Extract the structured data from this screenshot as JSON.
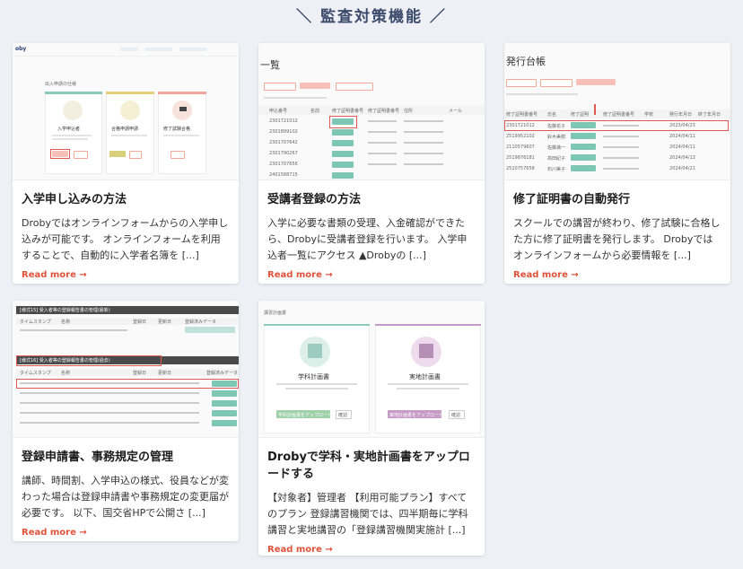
{
  "section": {
    "title": "＼ 監査対策機能 ／"
  },
  "cards": [
    {
      "title": "入学申し込みの方法",
      "excerpt": "Drobyではオンラインフォームからの入学申し込みが可能です。 オンラインフォームを利用することで、自動的に入学者名簿を [...]",
      "read_more": "Read more →",
      "thumb": {
        "logo": "oby",
        "heading": "出入申請の仕様",
        "items": [
          "入学申込者",
          "合格申請申請",
          "修了試験合格"
        ]
      }
    },
    {
      "title": "受講者登録の方法",
      "excerpt": "入学に必要な書類の受理、入金確認ができたら、Drobyに受講者登録を行います。 入学申込者一覧にアクセス ▲Drobyの [...]",
      "read_more": "Read more →",
      "thumb": {
        "heading": "一覧",
        "cols": [
          "申込番号",
          "名前",
          "修了証明書番号",
          "修了証明書番号",
          "住所",
          "メール"
        ],
        "rows": [
          "2301721012",
          "2301899102",
          "2301707642",
          "2301790267",
          "2301707656",
          "2401588715"
        ]
      }
    },
    {
      "title": "修了証明書の自動発行",
      "excerpt": "スクールでの講習が終わり、修了試験に合格した方に修了証明書を発行します。 Drobyではオンラインフォームから必要情報を [...]",
      "read_more": "Read more →",
      "thumb": {
        "heading": "発行台帳",
        "cols": [
          "修了証明書番号",
          "氏名",
          "修了証明",
          "修了証明書番号",
          "学校",
          "発行年月日",
          "終了年月日"
        ],
        "rows": [
          "2301721012",
          "2519952102",
          "2110579607",
          "2519876181",
          "2510757658"
        ],
        "names": [
          "佐藤花子",
          "鈴木美樹",
          "佐藤満一",
          "高田紀子",
          "石川美子"
        ],
        "dates": [
          "2023/04/23",
          "2024/04/11",
          "2024/04/11",
          "2024/04/13",
          "2024/04/21"
        ]
      }
    },
    {
      "title": "登録申請書、事務規定の管理",
      "excerpt": "講師、時間割、入学申込の様式、役員などが変わった場合は登録申請書や事務規定の変更届が必要です。 以下、国交省HPで公開さ [...]",
      "read_more": "Read more →",
      "thumb": {
        "section1": "[様式15] 受入者等の登録報告書の管理(最新)",
        "section2": "[様式16] 受入者等の登録報告書の管理(過去)",
        "cols": [
          "タイムスタンプ",
          "名称",
          "登録日",
          "更新日",
          "登録済みデータ"
        ]
      }
    },
    {
      "title": "Drobyで学科・実地計画書をアップロードする",
      "excerpt": "【対象者】管理者 【利用可能プラン】すべてのプラン 登録講習機関では、四半期毎に学科講習と実地講習の「登録講習機関実施計 [...]",
      "read_more": "Read more →",
      "thumb": {
        "heading": "講習計画書",
        "left_title": "学科計画書",
        "right_title": "実地計画書",
        "left_btn": "学科計画書をアップロード",
        "right_btn": "実地計画書をアップロード",
        "small_btn": "確認"
      }
    }
  ],
  "colors": {
    "accent": "#e0523a",
    "teal": "#7ec7b4",
    "pink": "#f6c0b8",
    "heading": "#3c4a6b"
  }
}
